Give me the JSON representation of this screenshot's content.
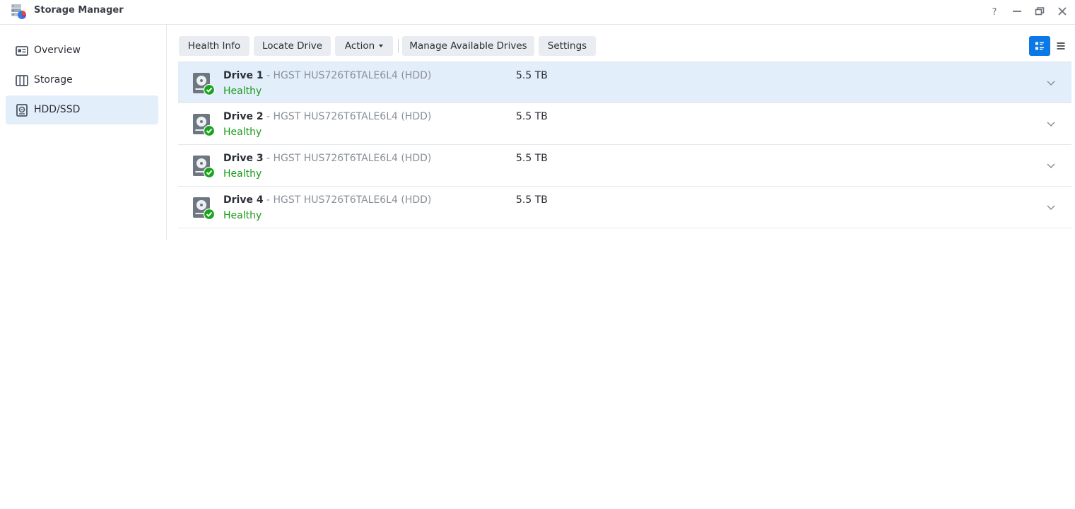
{
  "window": {
    "title": "Storage Manager",
    "icons": [
      "storage-manager-app-icon",
      "help-icon",
      "minimize-icon",
      "restore-icon",
      "close-icon"
    ]
  },
  "sidebar": {
    "items": [
      {
        "label": "Overview",
        "icon": "overview-icon",
        "active": false
      },
      {
        "label": "Storage",
        "icon": "storage-icon",
        "active": false
      },
      {
        "label": "HDD/SSD",
        "icon": "hdd-icon",
        "active": true
      }
    ]
  },
  "toolbar": {
    "health_info": "Health Info",
    "locate_drive": "Locate Drive",
    "action": "Action",
    "manage_available_drives": "Manage Available Drives",
    "settings": "Settings",
    "view_modes": [
      "detail-view-icon",
      "list-view-icon"
    ],
    "active_view": "detail"
  },
  "drives": [
    {
      "name": "Drive 1",
      "model": " - HGST HUS726T6TALE6L4 (HDD)",
      "status": "Healthy",
      "size": "5.5 TB",
      "selected": true
    },
    {
      "name": "Drive 2",
      "model": " - HGST HUS726T6TALE6L4 (HDD)",
      "status": "Healthy",
      "size": "5.5 TB",
      "selected": false
    },
    {
      "name": "Drive 3",
      "model": " - HGST HUS726T6TALE6L4 (HDD)",
      "status": "Healthy",
      "size": "5.5 TB",
      "selected": false
    },
    {
      "name": "Drive 4",
      "model": " - HGST HUS726T6TALE6L4 (HDD)",
      "status": "Healthy",
      "size": "5.5 TB",
      "selected": false
    }
  ],
  "colors": {
    "accent": "#0a78e6",
    "selected_row": "#e3eefb",
    "healthy": "#1a9c1a",
    "button_bg": "#e9edf1"
  }
}
